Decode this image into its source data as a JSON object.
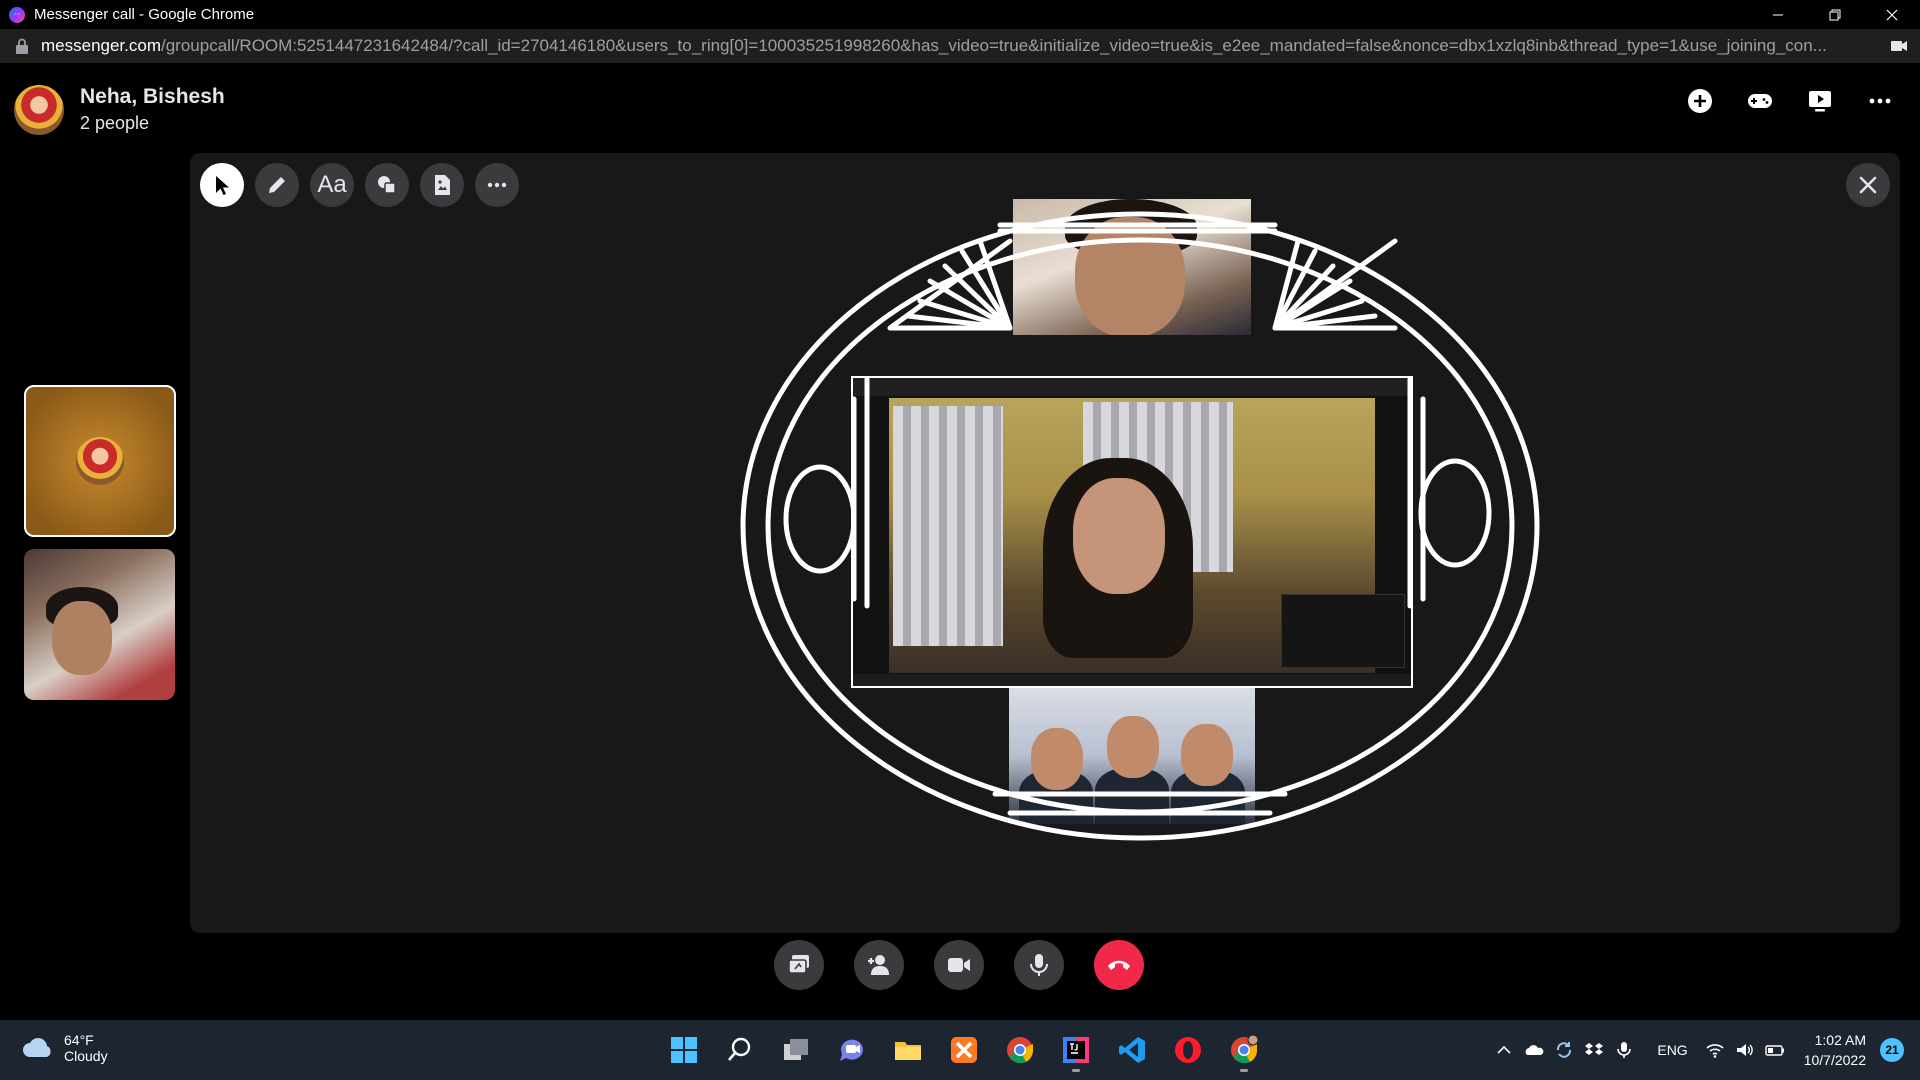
{
  "window": {
    "title": "Messenger call - Google Chrome"
  },
  "address_bar": {
    "host": "messenger.com",
    "path": "/groupcall/ROOM:5251447231642484/?call_id=2704146180&users_to_ring[0]=100035251998260&has_video=true&initialize_video=true&is_e2ee_mandated=false&nonce=dbx1xzlq8inb&thread_type=1&use_joining_con..."
  },
  "header": {
    "conversation_name": "Neha, Bishesh",
    "participant_count": "2 people"
  },
  "whiteboard": {
    "tools": [
      "select-icon",
      "pen-icon",
      "text-icon",
      "shapes-icon",
      "sticker-icon",
      "more-icon"
    ],
    "text_tool_label": "Aa"
  },
  "call_controls": [
    "share-screen-icon",
    "add-person-icon",
    "video-camera-icon",
    "microphone-icon",
    "end-call-icon"
  ],
  "taskbar": {
    "weather_temp": "64°F",
    "weather_condition": "Cloudy",
    "language": "ENG",
    "time": "1:02 AM",
    "date": "10/7/2022",
    "notification_count": "21",
    "apps": [
      "windows-start-icon",
      "search-icon",
      "task-view-icon",
      "chat-icon",
      "file-explorer-icon",
      "xampp-icon",
      "chrome-icon",
      "intellij-icon",
      "vscode-icon",
      "opera-icon",
      "chrome-profile-icon"
    ]
  },
  "colors": {
    "end_call": "#f02849",
    "accent": "#4cc2ff",
    "stage_background": "#181818",
    "button_background": "#3a3b3c"
  }
}
